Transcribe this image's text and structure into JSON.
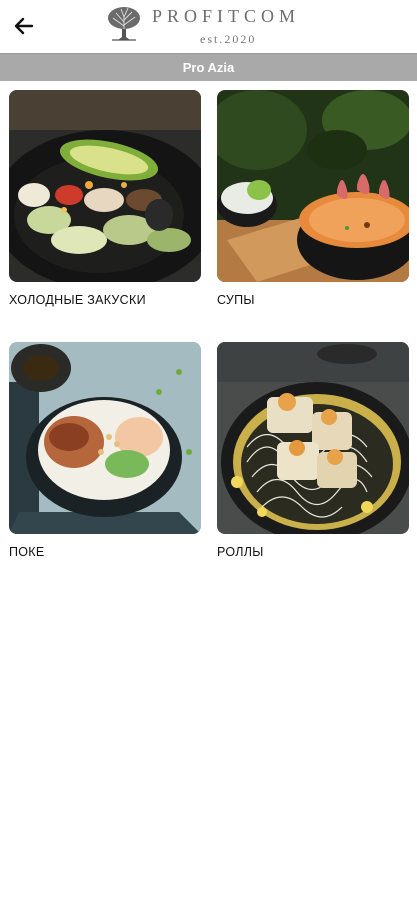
{
  "header": {
    "brand_name": "PROFITCOM",
    "brand_tagline": "est.2020",
    "back_icon": "arrow-left-icon",
    "logo_icon": "tree-icon"
  },
  "sub_bar": {
    "title": "Pro Azia"
  },
  "categories": [
    {
      "label": "ХОЛОДНЫЕ ЗАКУСКИ",
      "image": "salad-dish-photo"
    },
    {
      "label": "СУПЫ",
      "image": "soup-bowl-photo"
    },
    {
      "label": "ПОКЕ",
      "image": "poke-bowl-photo"
    },
    {
      "label": "РОЛЛЫ",
      "image": "rolls-plate-photo"
    }
  ],
  "colors": {
    "bar": "#a9a9a9",
    "text": "#111111",
    "logo": "#6e6e6e"
  }
}
